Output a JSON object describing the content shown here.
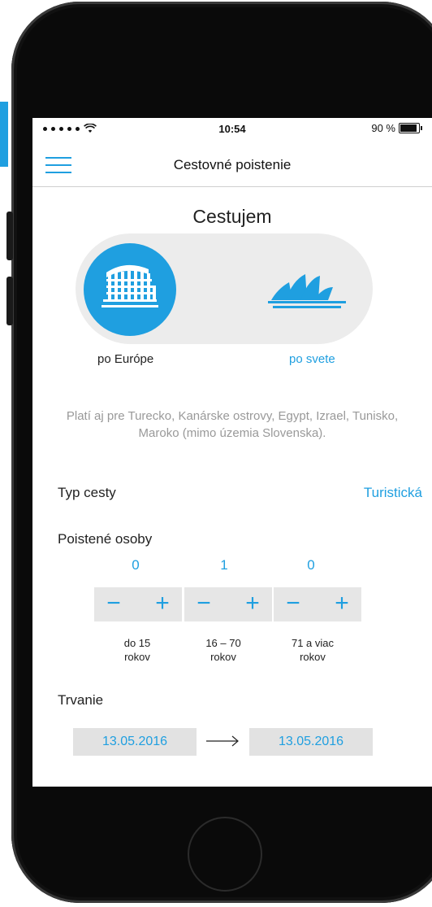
{
  "status": {
    "time": "10:54",
    "battery": "90 %",
    "battery_level": 0.9
  },
  "header": {
    "title": "Cestovné poistenie"
  },
  "trip_scope": {
    "title": "Cestujem",
    "options": [
      {
        "label": "po Európe",
        "icon": "colosseum-icon",
        "selected": true
      },
      {
        "label": "po svete",
        "icon": "sydney-opera-icon",
        "selected": false
      }
    ],
    "note": "Platí aj pre Turecko, Kanárske ostrovy, Egypt, Izrael, Tunisko, Maroko (mimo územia Slovenska)."
  },
  "trip_type": {
    "label": "Typ cesty",
    "value": "Turistická"
  },
  "insured": {
    "label": "Poistené osoby",
    "groups": [
      {
        "count": "0",
        "age_line1": "do 15",
        "age_line2": "rokov"
      },
      {
        "count": "1",
        "age_line1": "16 – 70",
        "age_line2": "rokov"
      },
      {
        "count": "0",
        "age_line1": "71 a viac",
        "age_line2": "rokov"
      }
    ],
    "minus": "−",
    "plus": "+"
  },
  "duration": {
    "label": "Trvanie",
    "from": "13.05.2016",
    "to": "13.05.2016"
  },
  "colors": {
    "accent": "#1f9fe0",
    "field_bg": "#e6e6e6"
  }
}
